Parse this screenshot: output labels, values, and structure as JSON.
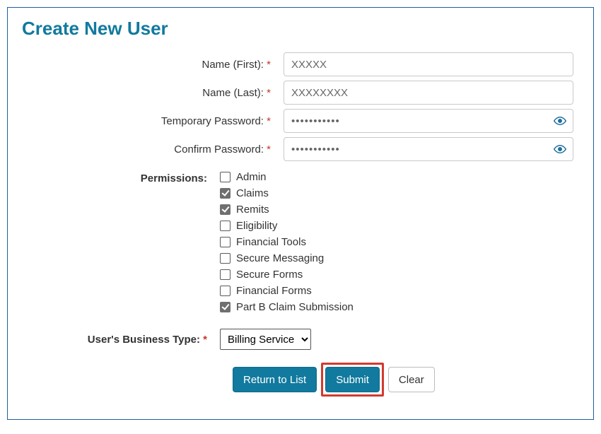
{
  "title": "Create New User",
  "fields": {
    "first_label": "Name (First):",
    "first_value": "XXXXX",
    "last_label": "Name (Last):",
    "last_value": "XXXXXXXX",
    "temp_pw_label": "Temporary Password:",
    "temp_pw_value": "•••••••••••",
    "confirm_pw_label": "Confirm Password:",
    "confirm_pw_value": "•••••••••••"
  },
  "required_marker": "*",
  "permissions_label": "Permissions:",
  "permissions": [
    {
      "label": "Admin",
      "checked": false
    },
    {
      "label": "Claims",
      "checked": true
    },
    {
      "label": "Remits",
      "checked": true
    },
    {
      "label": "Eligibility",
      "checked": false
    },
    {
      "label": "Financial Tools",
      "checked": false
    },
    {
      "label": "Secure Messaging",
      "checked": false
    },
    {
      "label": "Secure Forms",
      "checked": false
    },
    {
      "label": "Financial Forms",
      "checked": false
    },
    {
      "label": "Part B Claim Submission",
      "checked": true
    }
  ],
  "business_type_label": "User's Business Type:",
  "business_type_value": "Billing Service",
  "buttons": {
    "return": "Return to List",
    "submit": "Submit",
    "clear": "Clear"
  }
}
